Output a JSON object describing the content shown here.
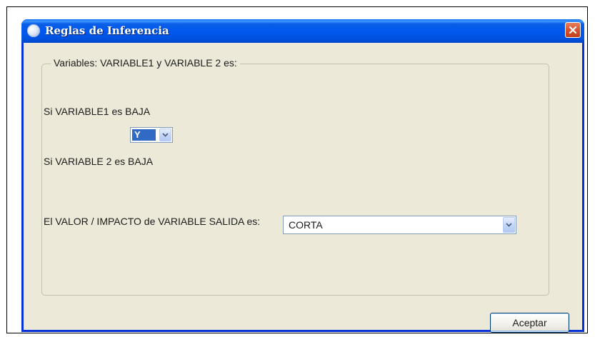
{
  "window": {
    "title": "Reglas de Inferencia",
    "icon": "app-icon",
    "close_icon": "close-icon"
  },
  "group": {
    "legend": "Variables: VARIABLE1 y VARIABLE 2 es:"
  },
  "conditions": {
    "variable1_label": "Si VARIABLE1 es BAJA",
    "operator_selected": "Y",
    "variable2_label": "Si VARIABLE 2 es BAJA"
  },
  "output": {
    "label": "El VALOR / IMPACTO de VARIABLE SALIDA es:",
    "selected": "CORTA"
  },
  "buttons": {
    "accept_label": "Aceptar"
  },
  "colors": {
    "titlebar": "#0058ee",
    "window_bg": "#ece9d8",
    "selection": "#316ac5",
    "close_button": "#d8532e"
  }
}
